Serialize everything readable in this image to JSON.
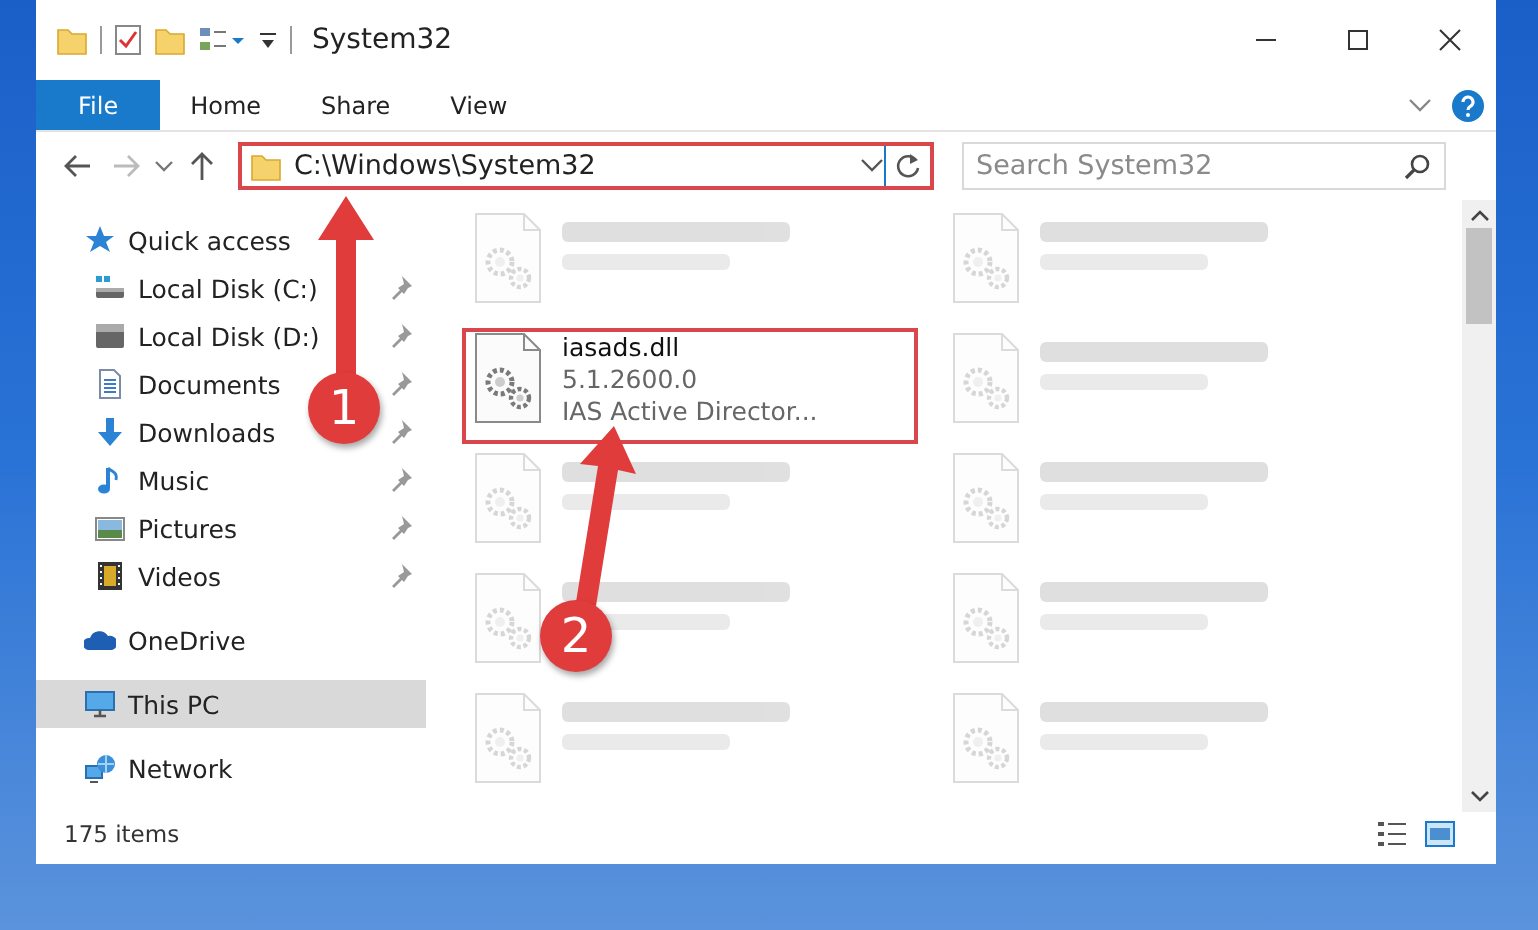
{
  "window": {
    "title": "System32"
  },
  "ribbon_tabs": [
    {
      "label": "File",
      "selected": true
    },
    {
      "label": "Home",
      "selected": false
    },
    {
      "label": "Share",
      "selected": false
    },
    {
      "label": "View",
      "selected": false
    }
  ],
  "address_bar": {
    "value": "C:\\Windows\\System32",
    "highlighted": true
  },
  "search": {
    "placeholder": "Search System32"
  },
  "sidebar": {
    "items": [
      {
        "label": "Quick access",
        "selected": false,
        "children": [
          {
            "label": "Local Disk (C:)",
            "pinned": true
          },
          {
            "label": "Local Disk (D:)",
            "pinned": true
          },
          {
            "label": "Documents",
            "pinned": true
          },
          {
            "label": "Downloads",
            "pinned": true
          },
          {
            "label": "Music",
            "pinned": true
          },
          {
            "label": "Pictures",
            "pinned": true
          },
          {
            "label": "Videos",
            "pinned": true
          }
        ]
      },
      {
        "label": "OneDrive",
        "selected": false
      },
      {
        "label": "This PC",
        "selected": true
      },
      {
        "label": "Network",
        "selected": false
      }
    ]
  },
  "files": [
    {
      "blurred": true,
      "highlighted": false
    },
    {
      "blurred": true,
      "highlighted": false
    },
    {
      "name": "iasads.dll",
      "lines": [
        "5.1.2600.0",
        "IAS Active Director..."
      ],
      "blurred": false,
      "highlighted": true
    },
    {
      "blurred": true,
      "highlighted": false
    },
    {
      "blurred": true,
      "highlighted": false
    },
    {
      "blurred": true,
      "highlighted": false
    },
    {
      "blurred": true,
      "highlighted": false
    },
    {
      "blurred": true,
      "highlighted": false
    },
    {
      "blurred": true,
      "highlighted": false
    },
    {
      "blurred": true,
      "highlighted": false
    }
  ],
  "status_bar": {
    "count": "175 items"
  },
  "annotations": [
    {
      "label": "1"
    },
    {
      "label": "2"
    }
  ]
}
